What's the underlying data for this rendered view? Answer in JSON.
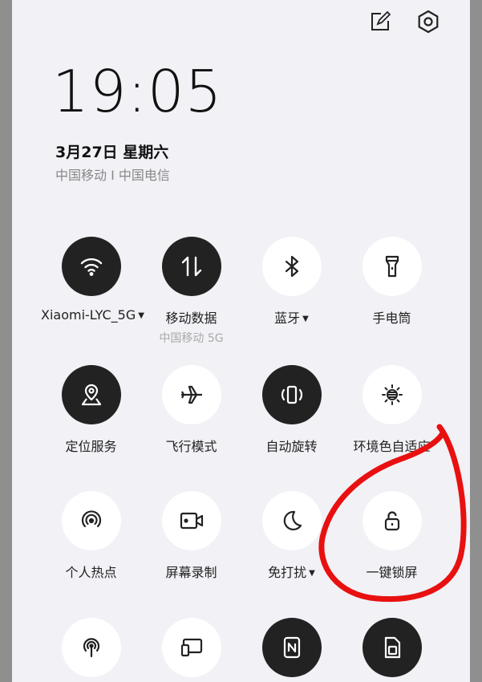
{
  "time": "19:05",
  "date": "3月27日  星期六",
  "carriers": "中国移动 I 中国电信",
  "top_icons": [
    "edit-icon",
    "settings-icon"
  ],
  "tiles": [
    {
      "id": "wifi",
      "label": "Xiaomi-LYC_5G",
      "arrow": "▼",
      "sub": "",
      "dark": true,
      "icon": "wifi-icon"
    },
    {
      "id": "mobile-data",
      "label": "移动数据",
      "arrow": "",
      "sub": "中国移动 5G",
      "dark": true,
      "icon": "data-arrows-icon"
    },
    {
      "id": "bluetooth",
      "label": "蓝牙",
      "arrow": "▼",
      "sub": "",
      "dark": false,
      "icon": "bluetooth-icon"
    },
    {
      "id": "flashlight",
      "label": "手电筒",
      "arrow": "",
      "sub": "",
      "dark": false,
      "icon": "flashlight-icon"
    },
    {
      "id": "location",
      "label": "定位服务",
      "arrow": "",
      "sub": "",
      "dark": true,
      "icon": "location-icon"
    },
    {
      "id": "airplane",
      "label": "飞行模式",
      "arrow": "",
      "sub": "",
      "dark": false,
      "icon": "airplane-icon"
    },
    {
      "id": "rotate",
      "label": "自动旋转",
      "arrow": "",
      "sub": "",
      "dark": true,
      "icon": "rotate-icon"
    },
    {
      "id": "ambient",
      "label": "环境色自适应",
      "arrow": "",
      "sub": "",
      "dark": false,
      "icon": "ambient-color-icon"
    },
    {
      "id": "hotspot",
      "label": "个人热点",
      "arrow": "",
      "sub": "",
      "dark": false,
      "icon": "hotspot-icon"
    },
    {
      "id": "screen-record",
      "label": "屏幕录制",
      "arrow": "",
      "sub": "",
      "dark": false,
      "icon": "screen-record-icon"
    },
    {
      "id": "dnd",
      "label": "免打扰",
      "arrow": "▼",
      "sub": "",
      "dark": false,
      "icon": "moon-icon"
    },
    {
      "id": "lock",
      "label": "一键锁屏",
      "arrow": "",
      "sub": "",
      "dark": false,
      "icon": "lock-icon"
    },
    {
      "id": "broadcast",
      "label": "",
      "arrow": "",
      "sub": "",
      "dark": false,
      "icon": "broadcast-icon"
    },
    {
      "id": "cast",
      "label": "",
      "arrow": "",
      "sub": "",
      "dark": false,
      "icon": "screen-cast-icon"
    },
    {
      "id": "nfc",
      "label": "",
      "arrow": "",
      "sub": "",
      "dark": true,
      "icon": "nfc-icon"
    },
    {
      "id": "sim",
      "label": "",
      "arrow": "",
      "sub": "",
      "dark": true,
      "icon": "sim-card-icon"
    }
  ],
  "colors": {
    "dark_tile": "#222222",
    "light_tile": "#ffffff",
    "annotation": "#e81010",
    "panel": "#f1f1f6"
  }
}
